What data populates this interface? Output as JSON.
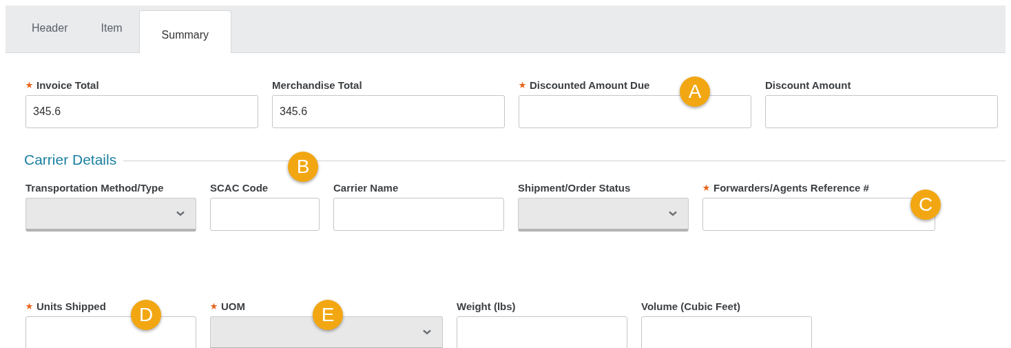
{
  "tabs": [
    {
      "label": "Header",
      "selected": false
    },
    {
      "label": "Item",
      "selected": false
    },
    {
      "label": "Summary",
      "selected": true
    }
  ],
  "totals": {
    "fields": [
      {
        "label": "Invoice Total",
        "required": true,
        "kind": "text",
        "value": "345.6"
      },
      {
        "label": "Merchandise Total",
        "required": false,
        "kind": "text",
        "value": "345.6"
      },
      {
        "label": "Discounted Amount Due",
        "required": true,
        "kind": "text"
      },
      {
        "label": "Discount Amount",
        "required": false,
        "kind": "text"
      }
    ]
  },
  "carrier_details": {
    "title": "Carrier Details",
    "rows": [
      [
        {
          "label": "Transportation Method/Type",
          "required": false,
          "kind": "select"
        },
        {
          "label": "SCAC Code",
          "required": false,
          "kind": "text"
        },
        {
          "label": "Carrier Name",
          "required": false,
          "kind": "text"
        },
        {
          "label": "Shipment/Order Status",
          "required": false,
          "kind": "select"
        },
        {
          "label": "Forwarders/Agents Reference #",
          "required": true,
          "kind": "text"
        }
      ],
      [
        {
          "label": "Units Shipped",
          "required": true,
          "kind": "text"
        },
        {
          "label": "UOM",
          "required": true,
          "kind": "select"
        },
        {
          "label": "Weight (lbs)",
          "required": false,
          "kind": "text"
        },
        {
          "label": "Volume (Cubic Feet)",
          "required": false,
          "kind": "text"
        }
      ]
    ]
  },
  "callouts": [
    "A",
    "B",
    "C",
    "D",
    "E"
  ]
}
